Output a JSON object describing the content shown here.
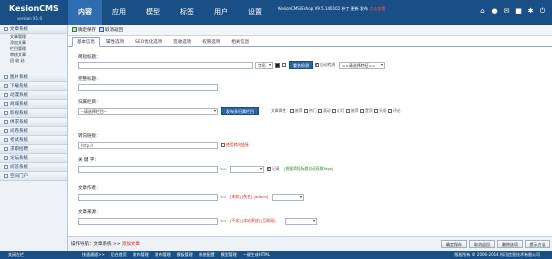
{
  "brand": {
    "name": "KesionCMS",
    "version": "version X1.0"
  },
  "nav": [
    "内容",
    "应用",
    "模型",
    "标签",
    "用户",
    "设置"
  ],
  "version_line": {
    "text": "KesionCMS/Eshop V9.5.140102 补丁 更新 发布",
    "highlight": "点击查看"
  },
  "sidebar": [
    {
      "label": "文章系统",
      "open": true,
      "children": [
        "文章管理",
        "添加文章",
        "栏目管理",
        "审核文章",
        "回 收 站"
      ]
    },
    {
      "label": "图片系统"
    },
    {
      "label": "下载系统"
    },
    {
      "label": "动漫系统"
    },
    {
      "label": "商城系统"
    },
    {
      "label": "影视系统"
    },
    {
      "label": "供求系统"
    },
    {
      "label": "问卷系统"
    },
    {
      "label": "考试系统"
    },
    {
      "label": "求职招聘"
    },
    {
      "label": "论坛系统"
    },
    {
      "label": "问答系统"
    },
    {
      "label": "空间门户"
    }
  ],
  "toolbar": {
    "save": "确定保存",
    "cancel": "取消返回"
  },
  "tabs": [
    "基本信息",
    "属性选项",
    "SEO优化选项",
    "签收选项",
    "权限选项",
    "相关信息"
  ],
  "form": {
    "title_label": "简短标题：",
    "title_font_select": "字形",
    "check_repeat_btn": "重名检测",
    "auto_detect": "自动检测",
    "mult_select": "==请选择特征==",
    "full_title_label": "完整标题：",
    "column_label": "归属栏目：",
    "column_select": "--请选择栏目--",
    "publish_multi_btn": "发布多归属栏目",
    "article_attr_label": "文章属性：",
    "article_attrs": [
      "推荐",
      "热门",
      "滚动",
      "幻灯",
      "推荐",
      "置顶",
      "头条",
      "评论"
    ],
    "redirect_label": "转向链接：",
    "redirect_value": "http://",
    "use_redirect": "使用转向链接",
    "keywords_label": "关 键 字：",
    "keywords_check": "记录",
    "keywords_hint": "[根据简短标题自动获取Tags]",
    "author_label": "文章作者：",
    "author_links": "[未知] [佚名] [admin]",
    "source_label": "文章来源：",
    "source_links": "[不详] [本站原创] [互联网]"
  },
  "bottom": {
    "crumb_label": "操作导航：",
    "crumb_path": "文章系统",
    "crumb_current": "添加文章",
    "buttons": [
      "确定保存",
      "取消返回",
      "删除选项",
      "提示方法"
    ]
  },
  "footer": {
    "left": "关闭左栏",
    "links": [
      "快速通道>>",
      "后台首页",
      "发布管理",
      "发布管理",
      "模板管理",
      "系统配置",
      "模型管理",
      "一键生成HTML"
    ],
    "copy": "版权所有 © 2006-2014 科汛信息技术有限公司"
  },
  "colors": {
    "topbar": "#1a4f86",
    "accent": "#2f6cb0",
    "warn": "#d42020",
    "ok": "#2a8a2a"
  }
}
